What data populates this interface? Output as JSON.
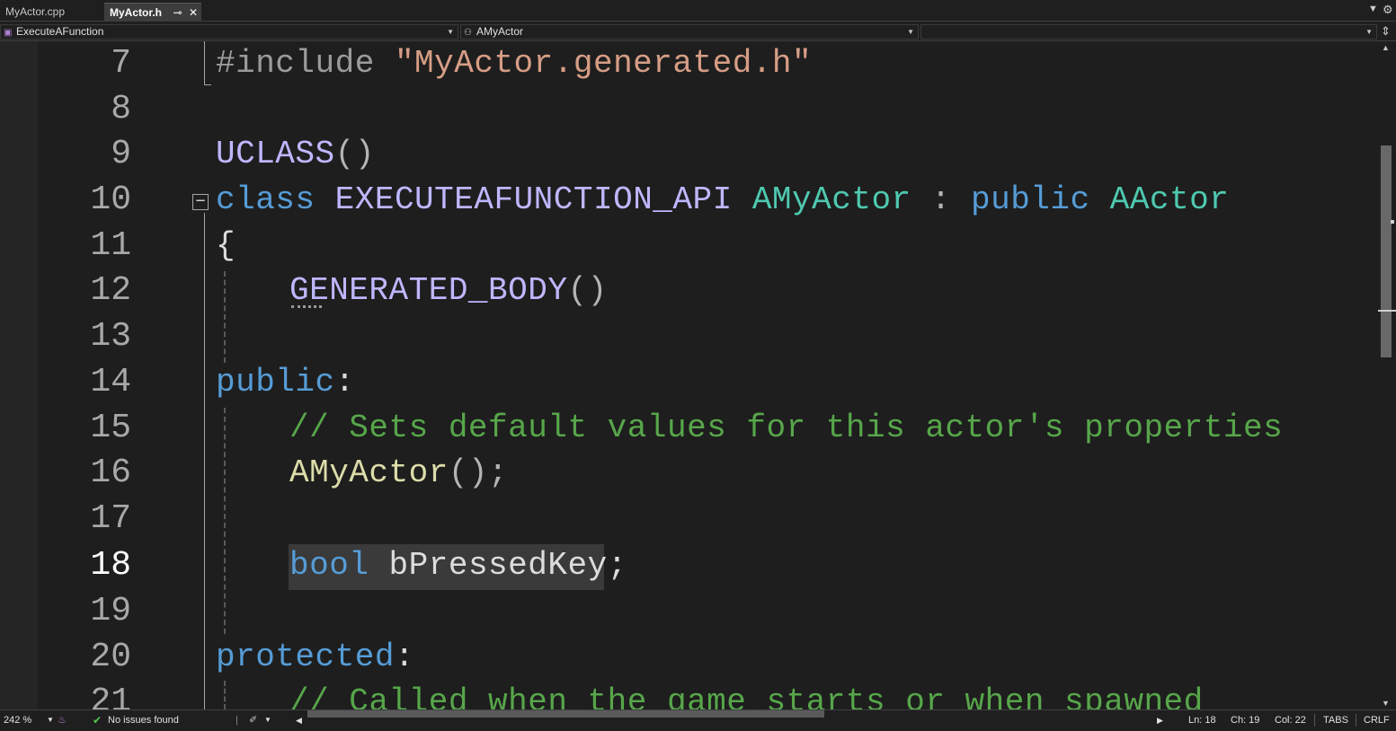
{
  "tabs": [
    {
      "label": "MyActor.cpp",
      "active": false
    },
    {
      "label": "MyActor.h",
      "active": true,
      "pin_icon": "pin-icon",
      "close_icon": "close-icon"
    }
  ],
  "tab_overflow_icon": "chevron-down-icon",
  "navbar": {
    "member_dropdown": "ExecuteAFunction",
    "class_dropdown": "AMyActor",
    "extra_dropdown": "",
    "split_icon": "split-window-icon"
  },
  "editor": {
    "lines": [
      {
        "num": "7"
      },
      {
        "num": "8"
      },
      {
        "num": "9"
      },
      {
        "num": "10"
      },
      {
        "num": "11"
      },
      {
        "num": "12"
      },
      {
        "num": "13"
      },
      {
        "num": "14"
      },
      {
        "num": "15"
      },
      {
        "num": "16"
      },
      {
        "num": "17"
      },
      {
        "num": "18",
        "current": true
      },
      {
        "num": "19"
      },
      {
        "num": "20"
      },
      {
        "num": "21"
      }
    ],
    "tokens": {
      "l7_include": "#include",
      "l7_string": "\"MyActor.generated.h\"",
      "l9_macro": "UCLASS",
      "l9_parens": "()",
      "l10_class": "class",
      "l10_api": "EXECUTEAFUNCTION_API",
      "l10_name": "AMyActor",
      "l10_colon": ":",
      "l10_public": "public",
      "l10_base": "AActor",
      "l11_brace": "{",
      "l12_macro": "GENERATED_BODY",
      "l12_parens": "()",
      "l14_public": "public",
      "l14_colon": ":",
      "l15_comment": "// Sets default values for this actor's properties",
      "l16_ctor": "AMyActor",
      "l16_rest": "();",
      "l18_bool": "bool",
      "l18_var": "bPressedKey;",
      "l20_protected": "protected",
      "l20_colon": ":",
      "l21_comment": "// Called when the game starts or when spawned"
    },
    "colors": {
      "keyword": "#569cd6",
      "type": "#4ec9b0",
      "string": "#d69d85",
      "macro": "#beb7ff",
      "function": "#dcdcaa",
      "comment": "#57a64a",
      "background": "#1e1e1e"
    }
  },
  "statusbar": {
    "zoom": "242 %",
    "issues": "No issues found",
    "line": "Ln: 18",
    "char": "Ch: 19",
    "col": "Col: 22",
    "indent": "TABS",
    "eol": "CRLF"
  }
}
